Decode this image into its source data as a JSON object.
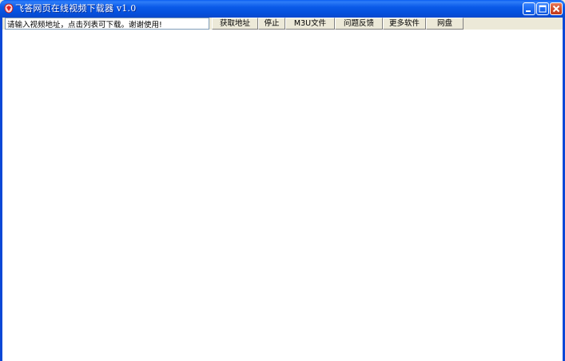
{
  "window": {
    "title": "飞答网页在线视频下载器 v1.0",
    "icon": "app-logo-icon",
    "controls": {
      "minimize": "minimize-icon",
      "maximize": "maximize-icon",
      "close": "close-icon"
    }
  },
  "toolbar": {
    "url_input_value": "请输入视频地址，点击列表可下载。谢谢使用!",
    "buttons": [
      "获取地址",
      "停止",
      "M3U文件",
      "问题反馈",
      "更多软件",
      "网盘"
    ]
  },
  "colors": {
    "titlebar": "#0a5ef2",
    "close_button": "#d3502f",
    "toolbar_background": "#ece9d8",
    "content_background": "#ffffff"
  }
}
